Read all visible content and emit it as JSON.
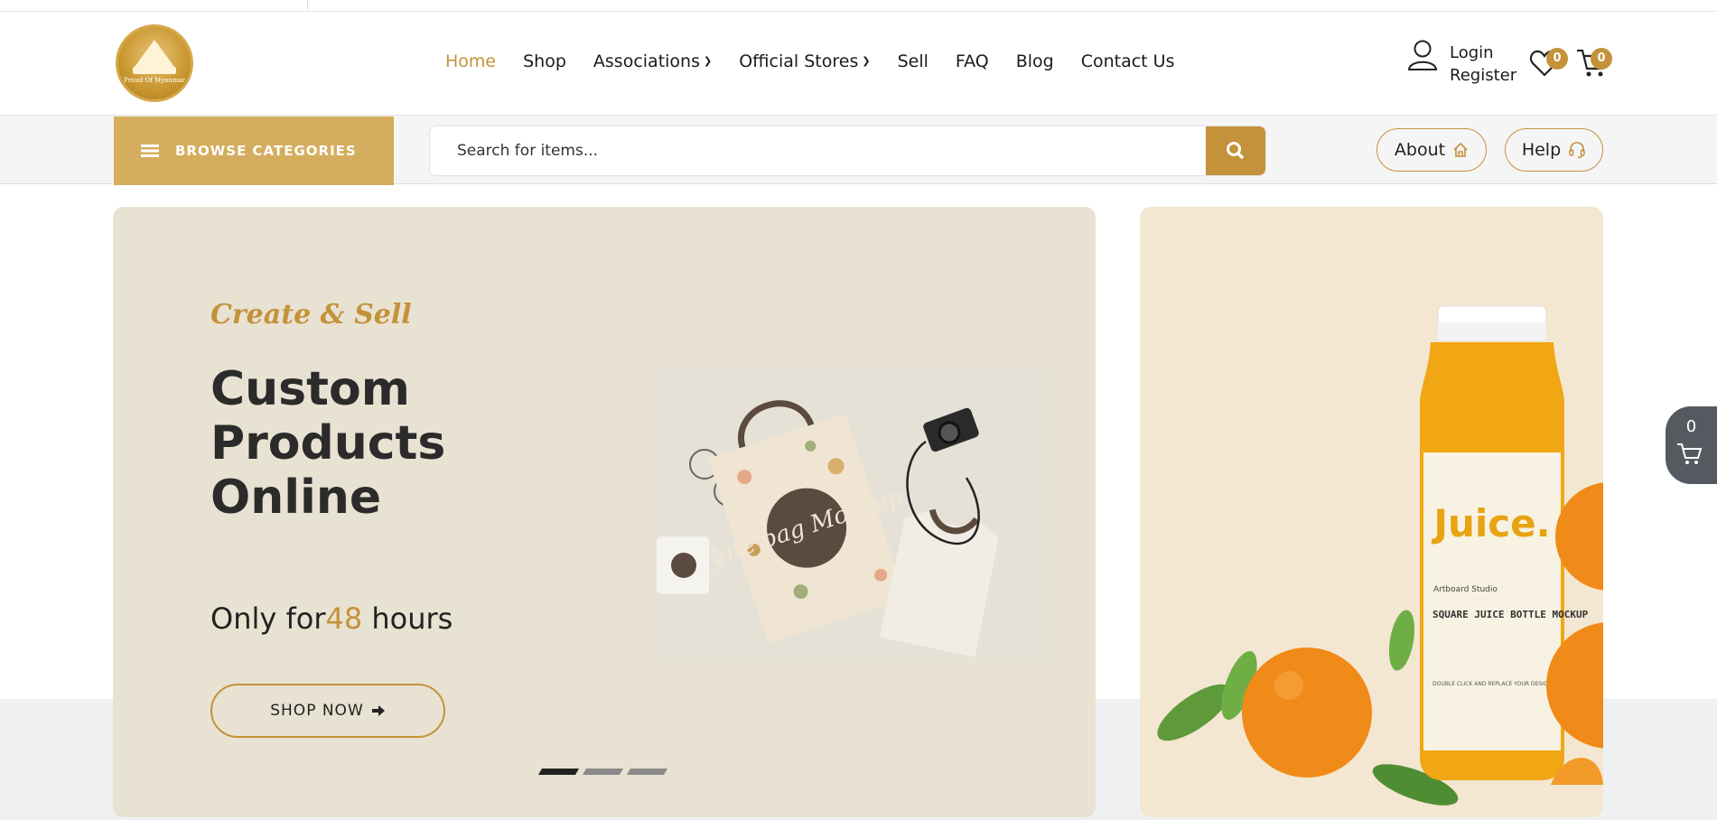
{
  "logo": {
    "text": "Proud Of Myanmar"
  },
  "nav": [
    {
      "label": "Home",
      "active": true
    },
    {
      "label": "Shop"
    },
    {
      "label": "Associations",
      "has_dropdown": true
    },
    {
      "label": "Official Stores",
      "has_dropdown": true
    },
    {
      "label": "Sell"
    },
    {
      "label": "FAQ"
    },
    {
      "label": "Blog"
    },
    {
      "label": "Contact Us"
    }
  ],
  "account": {
    "login": "Login",
    "register": "Register",
    "icon": "user-icon"
  },
  "wishlist": {
    "count": "0",
    "icon": "heart-icon"
  },
  "cart": {
    "count": "0",
    "icon": "cart-icon"
  },
  "categories": {
    "label": "BROWSE CATEGORIES",
    "icon": "list-icon"
  },
  "search": {
    "placeholder": "Search for items...",
    "icon": "search-icon"
  },
  "about": {
    "label": "About",
    "icon": "home-icon"
  },
  "help": {
    "label": "Help",
    "icon": "headset-icon"
  },
  "hero": {
    "kicker": "Create & Sell",
    "title": "Custom\nProducts\nOnline",
    "offer_prefix": "Only for",
    "offer_number": "48",
    "offer_suffix": " hours",
    "button": "SHOP NOW",
    "button_icon": "arrow-right-icon",
    "product_text": "tote bag Mockup",
    "slides": 3,
    "active_slide": 1
  },
  "side_banner": {
    "label_big": "Juice.",
    "label_small": "Artboard Studio",
    "label_title": "SQUARE JUICE BOTTLE MOCKUP",
    "label_note": "DOUBLE CLICK AND REPLACE YOUR DESIGN EASILY"
  },
  "floating_cart": {
    "count": "0",
    "icon": "cart-icon"
  },
  "colors": {
    "accent": "#c4923a",
    "browse_bg": "#d4ad5e",
    "hero_bg": "#e8e2d2",
    "side_bg": "#f3e7d1"
  }
}
